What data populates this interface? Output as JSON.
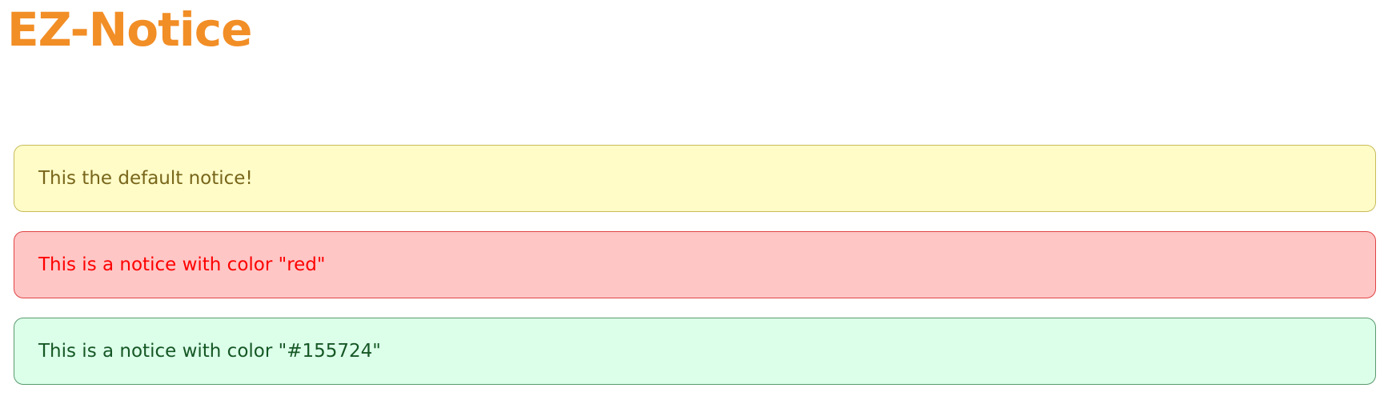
{
  "header": {
    "title": "EZ-Notice",
    "title_color": "#f28e26"
  },
  "notices": [
    {
      "text": "This the default notice!",
      "background": "#fffcc8",
      "border": "#c8bb5a",
      "text_color": "#78661a"
    },
    {
      "text": "This is a notice with color \"red\"",
      "background": "#ffc6c6",
      "border": "#e04444",
      "text_color": "#ff0000"
    },
    {
      "text": "This is a notice with color \"#155724\"",
      "background": "#dcffea",
      "border": "#5a9a6e",
      "text_color": "#155724"
    }
  ]
}
